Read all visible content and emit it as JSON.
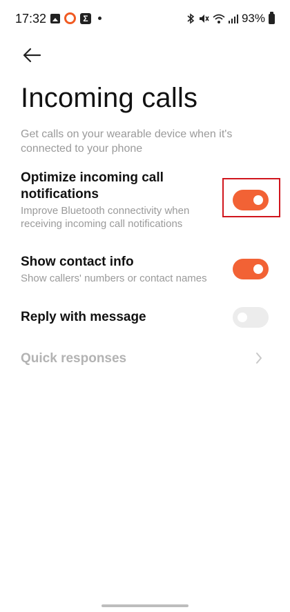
{
  "status_bar": {
    "time": "17:32",
    "battery_percent": "93%",
    "left_icons": [
      "gallery-icon",
      "ring-icon",
      "sigma-icon",
      "dot-icon"
    ],
    "right_icons": [
      "bluetooth-icon",
      "mute-icon",
      "wifi-icon",
      "signal-icon",
      "battery-icon"
    ]
  },
  "header": {
    "back_icon": "arrow-left-icon"
  },
  "page": {
    "title": "Incoming calls",
    "description": "Get calls on your wearable device when it's connected to your phone"
  },
  "settings": [
    {
      "title": "Optimize incoming call notifications",
      "subtitle": "Improve Bluetooth connectivity when receiving incoming call notifications",
      "toggle_on": true
    },
    {
      "title": "Show contact info",
      "subtitle": "Show callers' numbers or contact names",
      "toggle_on": true
    },
    {
      "title": "Reply with message",
      "toggle_on": false
    },
    {
      "title": "Quick responses",
      "disabled": true
    }
  ],
  "colors": {
    "accent": "#f26235",
    "toggle_off": "#ececec",
    "highlight": "#d0141c",
    "secondary_text": "#9a9a9a",
    "disabled_text": "#b3b3b3"
  }
}
